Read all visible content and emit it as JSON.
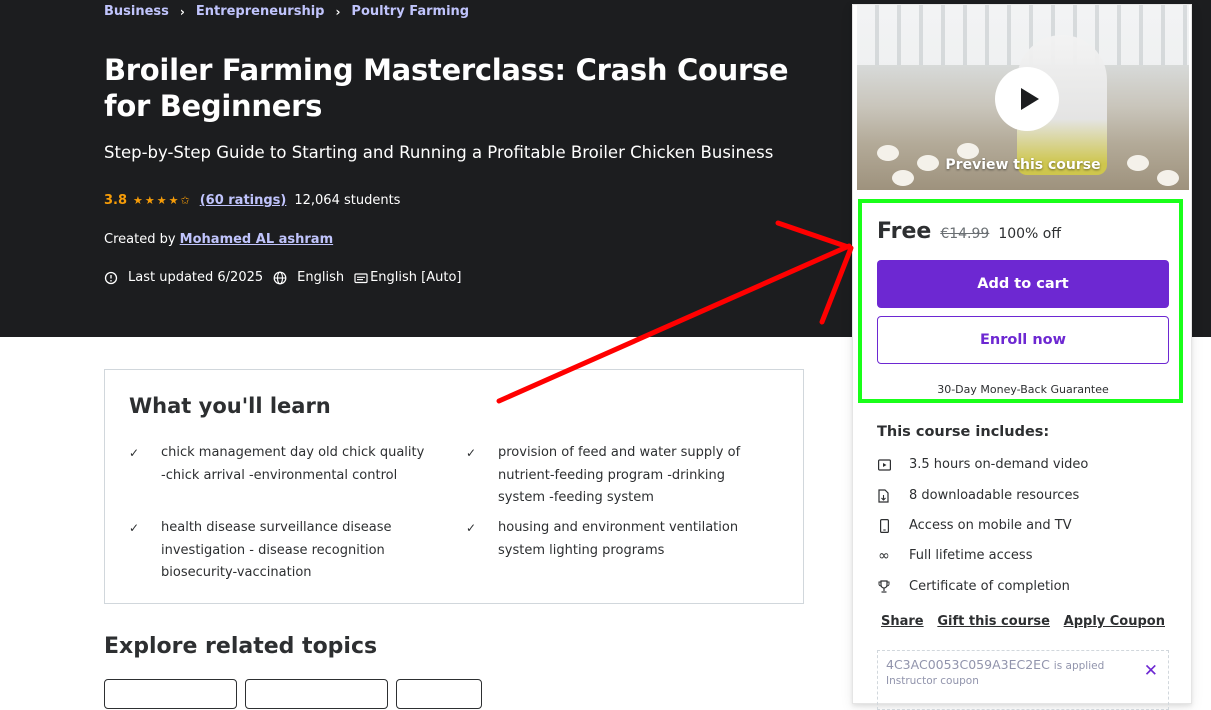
{
  "breadcrumb": [
    "Business",
    "Entrepreneurship",
    "Poultry Farming"
  ],
  "course": {
    "title": "Broiler Farming Masterclass: Crash Course for Beginners",
    "subtitle": "Step-by-Step Guide to Starting and Running a Profitable Broiler Chicken Business",
    "rating": "3.8",
    "stars": "★★★★✩",
    "rating_value": 3.8,
    "ratings_count": "(60 ratings)",
    "students": "12,064 students",
    "created_by_label": "Created by",
    "instructor": "Mohamed AL ashram",
    "last_updated": "Last updated 6/2025",
    "language": "English",
    "captions": "English [Auto]"
  },
  "learn": {
    "title": "What you'll learn",
    "items": [
      "chick management day old chick quality -chick arrival -environmental control",
      "provision of feed and water supply of nutrient-feeding program -drinking system -feeding system",
      "health disease surveillance disease investigation - disease recognition biosecurity-vaccination",
      "housing and environment ventilation system lighting programs"
    ]
  },
  "explore": {
    "title": "Explore related topics"
  },
  "sidebar": {
    "preview_label": "Preview this course",
    "price": "Free",
    "original_price": "€14.99",
    "discount": "100% off",
    "add_to_cart": "Add to cart",
    "enroll_now": "Enroll now",
    "guarantee": "30-Day Money-Back Guarantee",
    "includes_title": "This course includes:",
    "includes": [
      {
        "icon": "video-icon",
        "text": "3.5 hours on-demand video"
      },
      {
        "icon": "download-file-icon",
        "text": "8 downloadable resources"
      },
      {
        "icon": "mobile-icon",
        "text": "Access on mobile and TV"
      },
      {
        "icon": "infinity-icon",
        "text": "Full lifetime access"
      },
      {
        "icon": "trophy-icon",
        "text": "Certificate of completion"
      }
    ],
    "share": "Share",
    "gift": "Gift this course",
    "apply_coupon": "Apply Coupon",
    "coupon_code": "4C3AC0053C059A3EC2EC",
    "coupon_applied": "is applied",
    "coupon_type": "Instructor coupon"
  },
  "colors": {
    "accent": "#6d28d2",
    "hero_bg": "#1c1d1f",
    "link": "#c0c4fc",
    "star": "#f69c08",
    "highlight": "#19ff19",
    "arrow": "#ff0000"
  }
}
